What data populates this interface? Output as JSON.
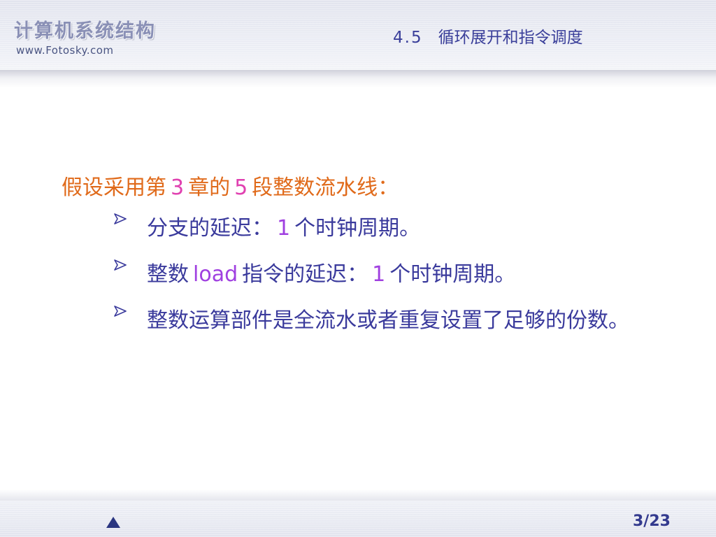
{
  "header": {
    "brand_title": "计算机系统结构",
    "brand_url": "www.Fotosky.com",
    "section_number": "4.5",
    "section_title": "循环展开和指令调度"
  },
  "content": {
    "intro": {
      "part1": "假设采用第",
      "num1": "3",
      "part2": "章的",
      "num2": "5",
      "part3": "段整数流水线："
    },
    "bullets": [
      {
        "pre": "分支的延迟：",
        "highlight": "1",
        "post": "个时钟周期。"
      },
      {
        "pre": "整数",
        "highlight1": "load",
        "mid": "指令的延迟：",
        "highlight2": "1",
        "post": "个时钟周期。"
      },
      {
        "text": "整数运算部件是全流水或者重复设置了足够的份数。"
      }
    ]
  },
  "footer": {
    "page_indicator": "3/23"
  },
  "colors": {
    "intro": "#e06a1a",
    "bullet_text": "#3a3a9c",
    "highlight": "#a040e0",
    "intro_number": "#e040b0"
  }
}
